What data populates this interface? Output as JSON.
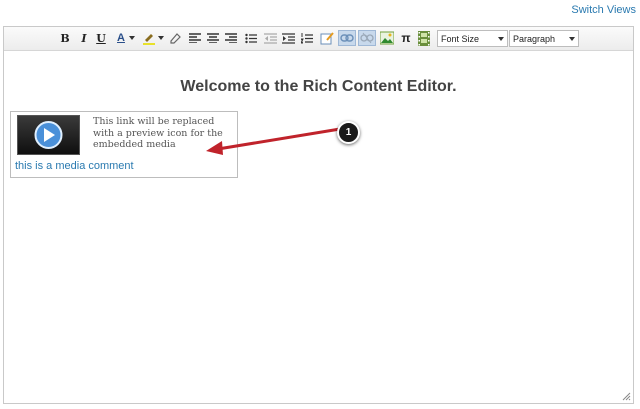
{
  "header": {
    "switch_views": "Switch Views"
  },
  "toolbar": {
    "bold": "B",
    "italic": "I",
    "underline": "U",
    "text_color": "A",
    "pi": "π",
    "font_size_select": "Font Size",
    "paragraph_select": "Paragraph"
  },
  "editor": {
    "heading": "Welcome to the Rich Content Editor.",
    "media_note": "This link will be replaced with a preview icon for the embedded media",
    "media_link": "this is a media comment"
  },
  "callout": {
    "number": "1",
    "color": "#c0232b"
  }
}
